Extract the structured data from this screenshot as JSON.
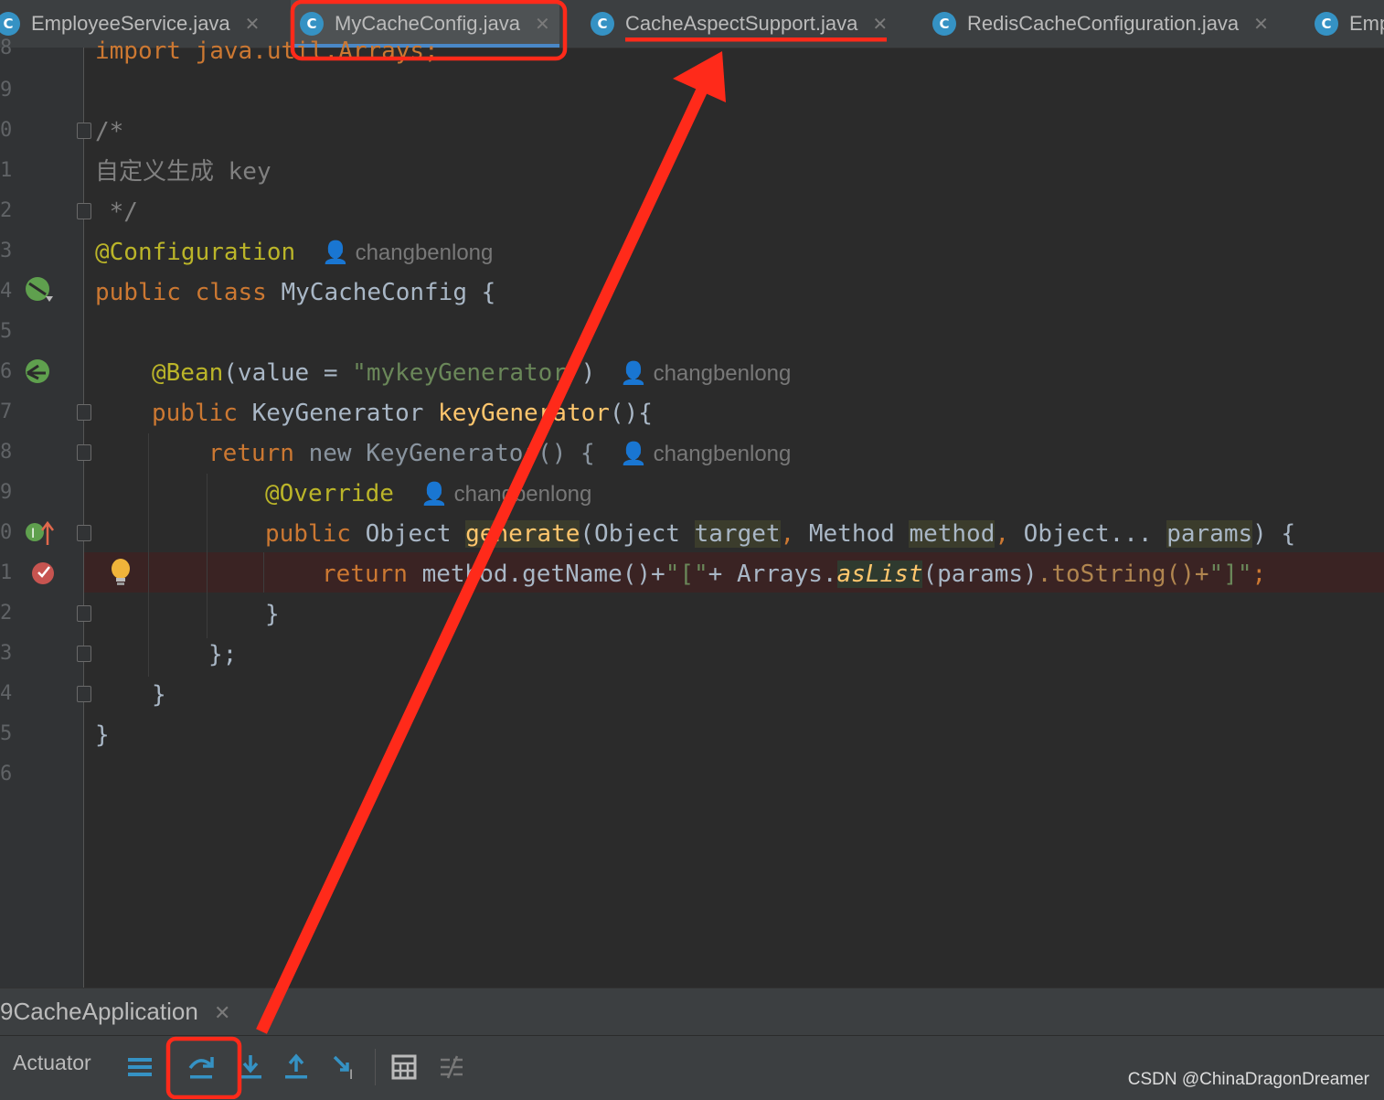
{
  "tabs": [
    {
      "label": "EmployeeService.java",
      "icon": "C"
    },
    {
      "label": "MyCacheConfig.java",
      "icon": "C"
    },
    {
      "label": "CacheAspectSupport.java",
      "icon": "C"
    },
    {
      "label": "RedisCacheConfiguration.java",
      "icon": "C"
    },
    {
      "label": "Emp",
      "icon": "C"
    }
  ],
  "line_numbers": [
    "8",
    "9",
    "0",
    "1",
    "2",
    "3",
    "4",
    "5",
    "6",
    "7",
    "8",
    "9",
    "0",
    "1",
    "2",
    "3",
    "4",
    "5",
    "6"
  ],
  "code": {
    "import_line": "import java.util.Arrays;",
    "comment_open": "/*",
    "comment_text": "自定义生成 key",
    "comment_close": " */",
    "ann_config": "@Configuration",
    "class_kw": "public class",
    "class_name": " MyCacheConfig {",
    "bean_ann": "@Bean",
    "bean_open": "(value = ",
    "bean_str": "\"mykeyGenerator\"",
    "bean_close": ")",
    "kg_kw": "public ",
    "kg_type": "KeyGenerator ",
    "kg_meth": "keyGenerator",
    "kg_rest": "(){",
    "ret_kw": "return ",
    "ret_new": "new ",
    "ret_rest": "KeyGenerator() {",
    "override": "@Override",
    "gen_kw": "public ",
    "gen_type": "Object ",
    "gen_meth": "generate",
    "gen_p1": "(Object ",
    "gen_target": "target",
    "gen_comma1": ", ",
    "gen_p2": "Method ",
    "gen_method": "method",
    "gen_comma2": ", ",
    "gen_p3": "Object... ",
    "gen_params": "params",
    "gen_close": ") {",
    "r2_kw": "return ",
    "r2_a": "method.getName()+",
    "r2_str1": "\"[\"",
    "r2_b": "+ Arrays.",
    "r2_aslist": "asList",
    "r2_c": "(params)",
    "r2_d": ".toString()+",
    "r2_str2": "\"]\"",
    "r2_semi": ";",
    "close1": "}",
    "close2": "};",
    "close3": "}",
    "close4": "}"
  },
  "author": "changbenlong",
  "run": {
    "tab_label": "9CacheApplication",
    "actuator_label": "Actuator"
  },
  "watermark": "CSDN @ChinaDragonDreamer",
  "colors": {
    "annotation_red": "#ff2a1a",
    "tab_accent": "#4a88c7"
  }
}
